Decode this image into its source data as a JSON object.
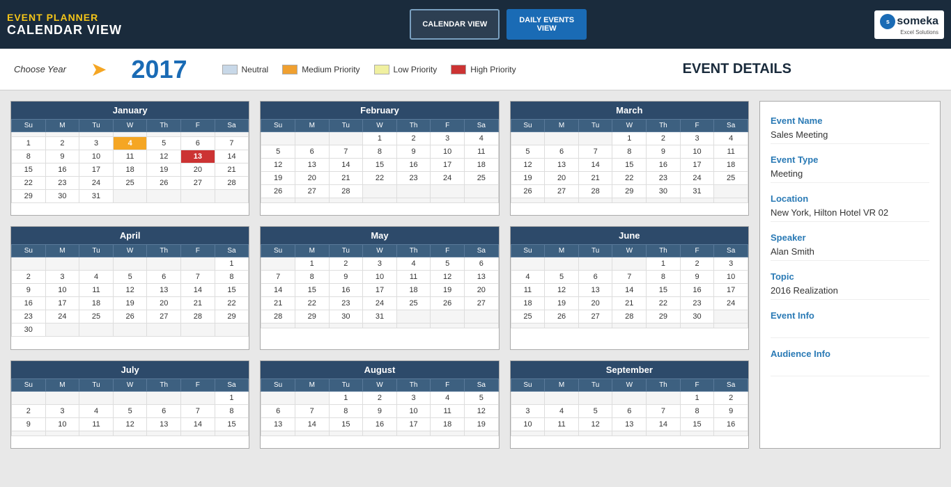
{
  "header": {
    "app_label": "EVENT PLANNER",
    "view_label": "CALENDAR VIEW",
    "btn_calendar": "CALENDAR VIEW",
    "btn_daily_line1": "DAILY EVENTS",
    "btn_daily_line2": "VIEW",
    "logo_name": "someka",
    "logo_sub": "Excel Solutions"
  },
  "year_bar": {
    "choose_year": "Choose Year",
    "year": "2017",
    "legend": [
      {
        "label": "Neutral",
        "type": "neutral"
      },
      {
        "label": "Low Priority",
        "type": "low"
      },
      {
        "label": "Medium Priority",
        "type": "medium"
      },
      {
        "label": "High Priority",
        "type": "high"
      }
    ],
    "event_details_title": "EVENT DETAILS"
  },
  "event_details": {
    "fields": [
      {
        "label": "Event Name",
        "value": "Sales Meeting"
      },
      {
        "label": "Event Type",
        "value": "Meeting"
      },
      {
        "label": "Location",
        "value": "New York, Hilton Hotel VR 02"
      },
      {
        "label": "Speaker",
        "value": "Alan Smith"
      },
      {
        "label": "Topic",
        "value": "2016 Realization"
      },
      {
        "label": "Event Info",
        "value": ""
      },
      {
        "label": "Audience Info",
        "value": ""
      }
    ]
  },
  "calendars": [
    {
      "month": "January",
      "days": [
        [
          "",
          "",
          "",
          "",
          "",
          "",
          ""
        ],
        [
          1,
          2,
          3,
          "4h",
          5,
          6,
          7
        ],
        [
          8,
          9,
          10,
          11,
          12,
          "13r",
          14
        ],
        [
          15,
          16,
          17,
          18,
          19,
          20,
          21
        ],
        [
          22,
          23,
          24,
          25,
          26,
          27,
          28
        ],
        [
          29,
          30,
          31,
          "",
          "",
          "",
          ""
        ]
      ]
    },
    {
      "month": "February",
      "days": [
        [
          "",
          "",
          "",
          "1",
          "2",
          "3",
          "4"
        ],
        [
          "5",
          "6",
          "7",
          "8",
          "9",
          "10",
          "11"
        ],
        [
          "12",
          "13",
          "14",
          "15",
          "16",
          "17",
          "18"
        ],
        [
          "19",
          "20",
          "21",
          "22",
          "23",
          "24",
          "25"
        ],
        [
          "26",
          "27",
          "28",
          "",
          "",
          "",
          ""
        ],
        [
          "",
          "",
          "",
          "",
          "",
          "",
          ""
        ]
      ]
    },
    {
      "month": "March",
      "days": [
        [
          "",
          "",
          "",
          "1",
          "2",
          "3",
          "4"
        ],
        [
          "5",
          "6",
          "7",
          "8",
          "9",
          "10",
          "11"
        ],
        [
          "12",
          "13",
          "14",
          "15",
          "16",
          "17",
          "18"
        ],
        [
          "19",
          "20",
          "21",
          "22",
          "23",
          "24",
          "25"
        ],
        [
          "26",
          "27",
          "28",
          "29",
          "30",
          "31",
          ""
        ],
        [
          "",
          "",
          "",
          "",
          "",
          "",
          ""
        ]
      ]
    },
    {
      "month": "April",
      "days": [
        [
          "",
          "",
          "",
          "",
          "",
          "",
          "1"
        ],
        [
          "2",
          "3",
          "4",
          "5",
          "6",
          "7",
          "8"
        ],
        [
          "9",
          "10",
          "11",
          "12",
          "13",
          "14",
          "15"
        ],
        [
          "16",
          "17",
          "18",
          "19",
          "20",
          "21",
          "22"
        ],
        [
          "23",
          "24",
          "25",
          "26",
          "27",
          "28",
          "29"
        ],
        [
          "30",
          "",
          "",
          "",
          "",
          "",
          ""
        ]
      ]
    },
    {
      "month": "May",
      "days": [
        [
          "",
          "1",
          "2",
          "3",
          "4",
          "5",
          "6"
        ],
        [
          "7",
          "8",
          "9",
          "10",
          "11",
          "12",
          "13"
        ],
        [
          "14",
          "15",
          "16",
          "17",
          "18",
          "19",
          "20"
        ],
        [
          "21",
          "22",
          "23",
          "24",
          "25",
          "26",
          "27"
        ],
        [
          "28",
          "29",
          "30",
          "31",
          "",
          "",
          ""
        ],
        [
          "",
          "",
          "",
          "",
          "",
          "",
          ""
        ]
      ]
    },
    {
      "month": "June",
      "days": [
        [
          "",
          "",
          "",
          "",
          "1",
          "2",
          "3"
        ],
        [
          "4",
          "5",
          "6",
          "7",
          "8",
          "9",
          "10"
        ],
        [
          "11",
          "12",
          "13",
          "14",
          "15",
          "16",
          "17"
        ],
        [
          "18",
          "19",
          "20",
          "21",
          "22",
          "23",
          "24"
        ],
        [
          "25",
          "26",
          "27",
          "28",
          "29",
          "30",
          ""
        ],
        [
          "",
          "",
          "",
          "",
          "",
          "",
          ""
        ]
      ]
    },
    {
      "month": "July",
      "days": [
        [
          "",
          "",
          "",
          "",
          "",
          "",
          "1"
        ],
        [
          "2",
          "3",
          "4",
          "5",
          "6",
          "7",
          "8"
        ],
        [
          "9",
          "10",
          "11",
          "12",
          "13",
          "14",
          "15"
        ],
        [
          "",
          "",
          "",
          "",
          "",
          "",
          ""
        ]
      ]
    },
    {
      "month": "August",
      "days": [
        [
          "",
          "",
          "1",
          "2",
          "3",
          "4",
          "5"
        ],
        [
          "6",
          "7",
          "8",
          "9",
          "10",
          "11",
          "12"
        ],
        [
          "13",
          "14",
          "15",
          "16",
          "17",
          "18",
          "19"
        ],
        [
          "",
          "",
          "",
          "",
          "",
          "",
          ""
        ]
      ]
    },
    {
      "month": "September",
      "days": [
        [
          "",
          "",
          "",
          "",
          "",
          "1",
          "2"
        ],
        [
          "3",
          "4",
          "5",
          "6",
          "7",
          "8",
          "9"
        ],
        [
          "10",
          "11",
          "12",
          "13",
          "14",
          "15",
          "16"
        ],
        [
          "",
          "",
          "",
          "",
          "",
          "",
          ""
        ]
      ]
    }
  ],
  "day_headers": [
    "Su",
    "M",
    "Tu",
    "W",
    "Th",
    "F",
    "Sa"
  ]
}
